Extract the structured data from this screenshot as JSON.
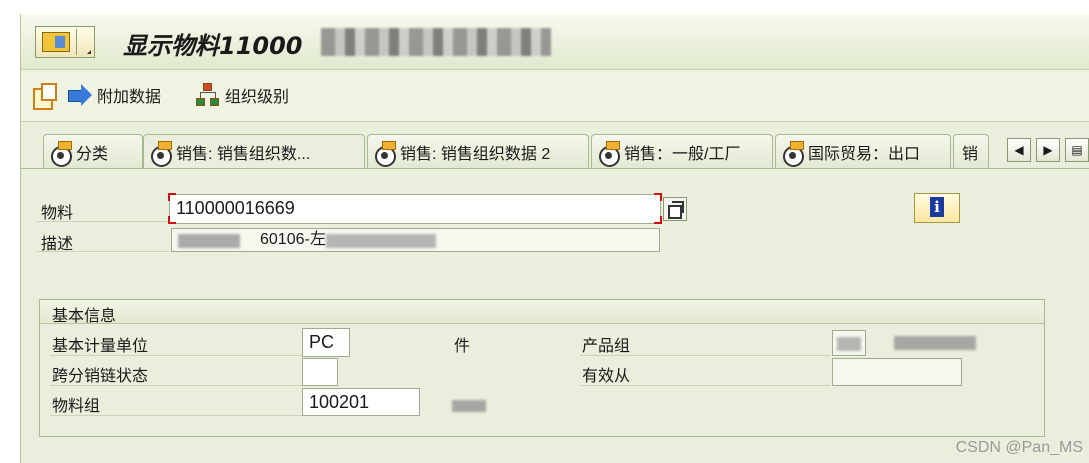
{
  "window": {
    "title": "显示物料11000"
  },
  "toolbar": {
    "additional_data": "附加数据",
    "org_levels": "组织级别"
  },
  "tabs": [
    {
      "label": "分类"
    },
    {
      "label": "销售: 销售组织数..."
    },
    {
      "label": "销售: 销售组织数据 2"
    },
    {
      "label": "销售：一般/工厂"
    },
    {
      "label": "国际贸易：出口"
    },
    {
      "label": "销"
    }
  ],
  "header_fields": {
    "material_label": "物料",
    "material_value": "110000016669",
    "description_label": "描述",
    "description_value": "60106-",
    "description_tail": "左"
  },
  "basic_info": {
    "title": "基本信息",
    "base_uom_label": "基本计量单位",
    "base_uom_value": "PC",
    "base_uom_text": "件",
    "product_group_label": "产品组",
    "xdist_status_label": "跨分销链状态",
    "valid_from_label": "有效从",
    "material_group_label": "物料组",
    "material_group_value": "100201"
  },
  "watermark": "CSDN @Pan_MS",
  "colors": {
    "background": "#e9efdc",
    "required_marker": "#d01010",
    "title_bar": "#e0e9cd"
  }
}
